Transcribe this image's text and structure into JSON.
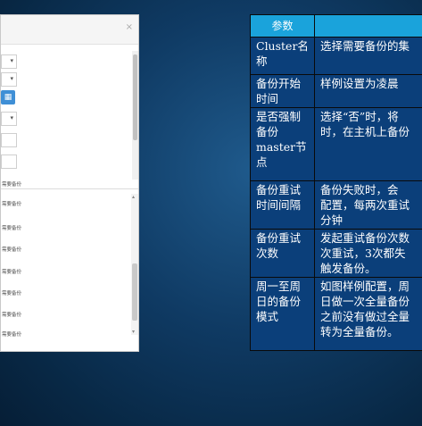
{
  "left_panel": {
    "close_icon": "×",
    "form_label": "需要备份",
    "list_items": [
      "需要备份",
      "需要备份",
      "需要备份",
      "需要备份",
      "需要备份",
      "需要备份",
      "需要备份"
    ]
  },
  "table": {
    "headers": [
      "参数",
      ""
    ],
    "rows": [
      {
        "param": "Cluster名称",
        "desc": [
          "选择需要备份的集"
        ]
      },
      {
        "param": "备份开始时间",
        "desc": [
          "样例设置为凌晨"
        ]
      },
      {
        "param": "是否强制备份master节点",
        "desc": [
          "选择“否”时，将",
          "时，在主机上备份"
        ]
      },
      {
        "param": "备份重试时间间隔",
        "desc": [
          "备份失败时，会",
          "配置，每两次重试",
          "分钟"
        ]
      },
      {
        "param": "备份重试次数",
        "desc": [
          "发起重试备份次数",
          "次重试，3次都失",
          "触发备份。"
        ]
      },
      {
        "param": "周一至周日的备份模式",
        "desc": [
          "如图样例配置，周",
          "日做一次全量备份",
          "之前没有做过全量",
          "转为全量备份。"
        ]
      }
    ]
  },
  "colors": {
    "header_bg": "#1aa3db",
    "cell_bg": "#0b3f7a",
    "calendar_button": "#3f8fd6"
  }
}
